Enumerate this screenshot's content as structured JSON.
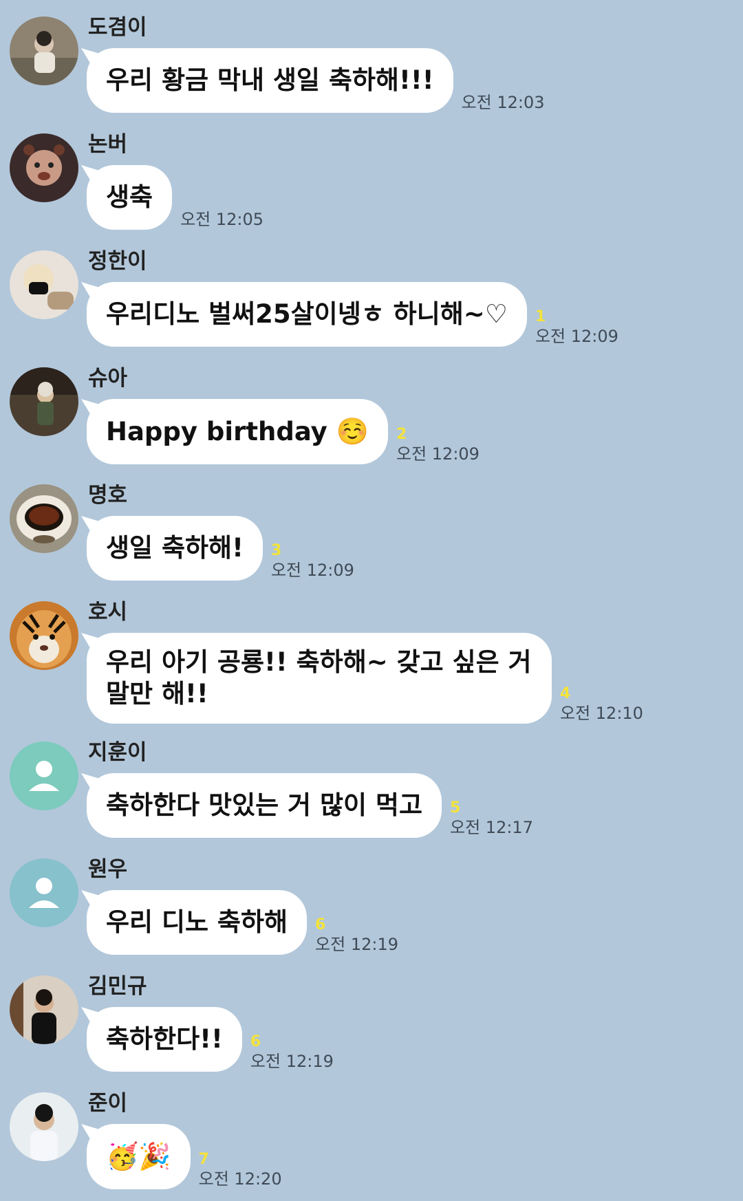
{
  "messages": [
    {
      "sender": "도겸이",
      "text": "우리 황금 막내 생일 축하해!!!",
      "unread": "",
      "time": "오전 12:03"
    },
    {
      "sender": "논버",
      "text": "생축",
      "unread": "",
      "time": "오전 12:05"
    },
    {
      "sender": "정한이",
      "text": "우리디노 벌써25살이넹ㅎ 하니해~♡",
      "unread": "1",
      "time": "오전 12:09"
    },
    {
      "sender": "슈아",
      "text": "Happy birthday",
      "emoji": "☺️",
      "unread": "2",
      "time": "오전 12:09"
    },
    {
      "sender": "명호",
      "text": "생일 축하해!",
      "unread": "3",
      "time": "오전 12:09"
    },
    {
      "sender": "호시",
      "text": "우리 아기 공룡!! 축하해~ 갖고 싶은 거 말만 해!!",
      "unread": "4",
      "time": "오전 12:10"
    },
    {
      "sender": "지훈이",
      "text": "축하한다 맛있는 거 많이 먹고",
      "unread": "5",
      "time": "오전 12:17"
    },
    {
      "sender": "원우",
      "text": "우리 디노 축하해",
      "unread": "6",
      "time": "오전 12:19"
    },
    {
      "sender": "김민규",
      "text": "축하한다!!",
      "unread": "6",
      "time": "오전 12:19"
    },
    {
      "sender": "준이",
      "text": "",
      "emoji": "🥳🎉",
      "unread": "7",
      "time": "오전 12:20"
    }
  ],
  "icons": {
    "default_avatar": "person-silhouette-icon"
  },
  "colors": {
    "background": "#b2c7da",
    "bubble": "#ffffff",
    "unread": "#f3e33b",
    "time": "#3f4a56",
    "default_avatar_teal": "#7ccbbd",
    "default_avatar_blue": "#86c1cc"
  }
}
